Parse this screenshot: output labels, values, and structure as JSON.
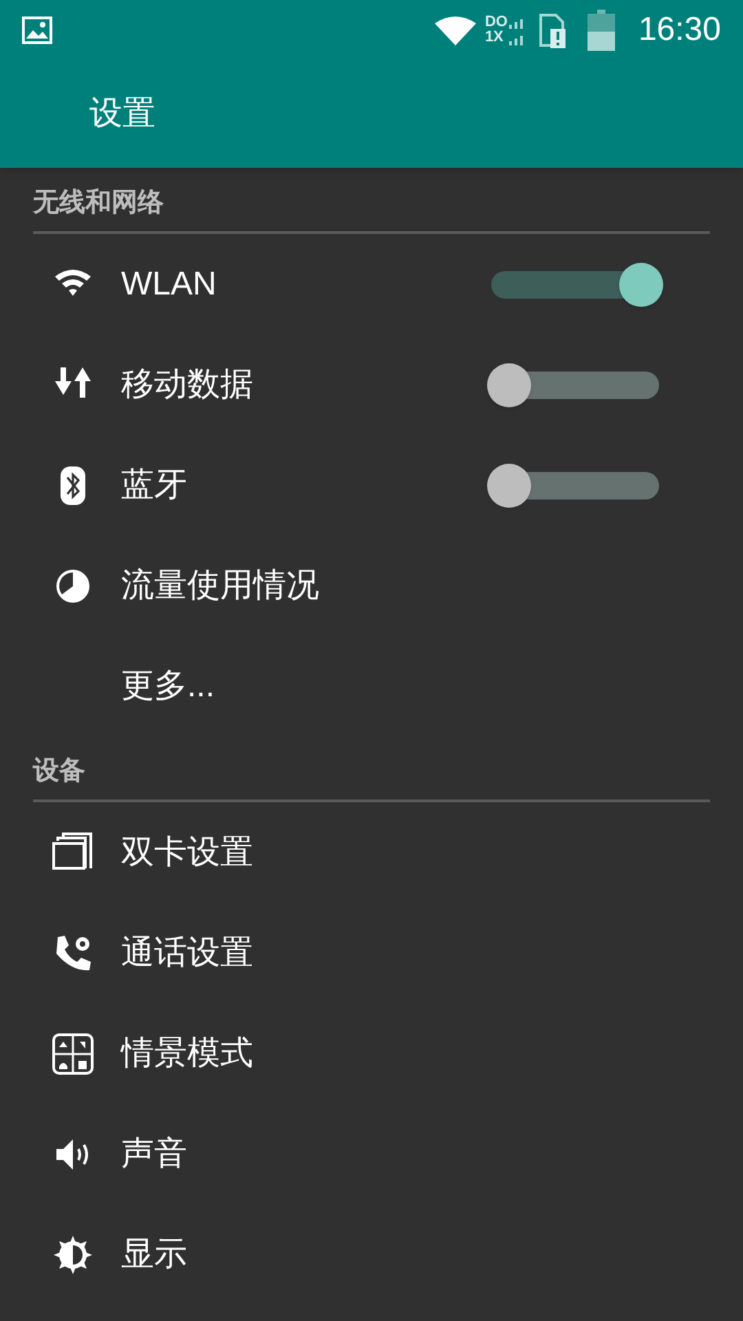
{
  "status_bar": {
    "time": "16:30",
    "network_label_top": "DO",
    "network_label_bottom": "1X"
  },
  "app_bar": {
    "title": "设置"
  },
  "sections": [
    {
      "title": "无线和网络",
      "items": [
        {
          "label": "WLAN",
          "kind": "toggle",
          "on": true
        },
        {
          "label": "移动数据",
          "kind": "toggle",
          "on": false
        },
        {
          "label": "蓝牙",
          "kind": "toggle",
          "on": false
        },
        {
          "label": "流量使用情况",
          "kind": "link"
        },
        {
          "label": "更多...",
          "kind": "link"
        }
      ]
    },
    {
      "title": "设备",
      "items": [
        {
          "label": "双卡设置",
          "kind": "link"
        },
        {
          "label": "通话设置",
          "kind": "link"
        },
        {
          "label": "情景模式",
          "kind": "link"
        },
        {
          "label": "声音",
          "kind": "link"
        },
        {
          "label": "显示",
          "kind": "link"
        }
      ]
    }
  ]
}
